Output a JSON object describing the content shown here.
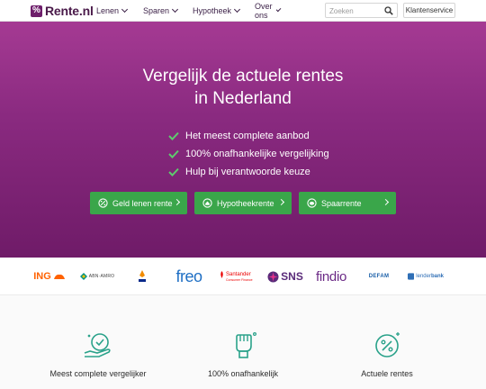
{
  "header": {
    "logo_mark": "%",
    "logo_text": "Rente.nl",
    "nav": [
      "Lenen",
      "Sparen",
      "Hypotheek",
      "Over ons"
    ],
    "search_placeholder": "Zoeken",
    "service_label": "Klantenservice"
  },
  "hero": {
    "title_line1": "Vergelijk de actuele rentes",
    "title_line2": "in Nederland",
    "bullets": [
      "Het meest complete aanbod",
      "100% onafhankelijke vergelijking",
      "Hulp bij verantwoorde keuze"
    ],
    "ctas": [
      "Geld lenen rente",
      "Hypotheekrente",
      "Spaarrente"
    ]
  },
  "partners": {
    "ing": "ING",
    "abn": "ABN·AMRO",
    "freo": "freo",
    "santander": "Santander",
    "santander_sub": "Consumer Finance",
    "sns": "SNS",
    "findio": "findio",
    "defam": "DEFAM",
    "lender": "lender",
    "lender_sub": "bank"
  },
  "features": [
    "Meest complete vergelijker",
    "100% onafhankelijk",
    "Actuele rentes"
  ],
  "colors": {
    "brand": "#6e1e6b",
    "hero_top": "#a53a93",
    "hero_bottom": "#6f1b68",
    "cta_green": "#3aa64a",
    "icon_teal": "#2aa28a"
  }
}
